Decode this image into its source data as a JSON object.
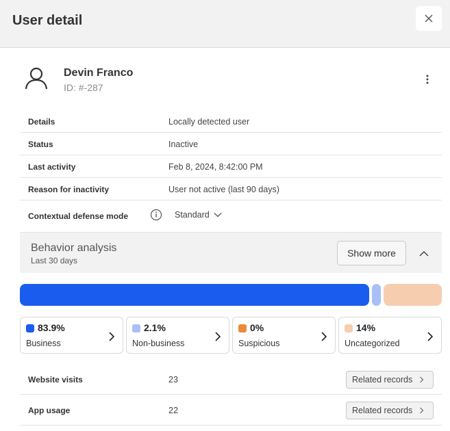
{
  "header": {
    "title": "User detail"
  },
  "user": {
    "name": "Devin Franco",
    "id": "ID: #-287"
  },
  "details": [
    {
      "label": "Details",
      "value": "Locally detected user"
    },
    {
      "label": "Status",
      "value": "Inactive"
    },
    {
      "label": "Last activity",
      "value": "Feb 8, 2024, 8:42:00 PM"
    },
    {
      "label": "Reason for inactivity",
      "value": "User not active (last 90 days)"
    }
  ],
  "contextual_defense": {
    "label": "Contextual defense mode",
    "value": "Standard"
  },
  "behavior": {
    "title": "Behavior analysis",
    "subtitle": "Last 30 days",
    "show_more_label": "Show more",
    "categories": [
      {
        "pct": "83.9%",
        "name": "Business",
        "share": 83.9,
        "color": "#1a5ced"
      },
      {
        "pct": "2.1%",
        "name": "Non-business",
        "share": 2.1,
        "color": "#a8c0f5"
      },
      {
        "pct": "0%",
        "name": "Suspicious",
        "share": 0,
        "color": "#ed8a3b"
      },
      {
        "pct": "14%",
        "name": "Uncategorized",
        "share": 14,
        "color": "#f7cdb0"
      }
    ]
  },
  "metrics": [
    {
      "label": "Website visits",
      "value": "23",
      "button": "Related records"
    },
    {
      "label": "App usage",
      "value": "22",
      "button": "Related records"
    }
  ],
  "icons": {
    "close": "close-icon",
    "avatar": "user-icon",
    "more": "more-vertical-icon",
    "info": "info-icon",
    "chevron_down": "chevron-down-icon",
    "chevron_up": "chevron-up-icon",
    "chevron_right": "chevron-right-icon"
  }
}
